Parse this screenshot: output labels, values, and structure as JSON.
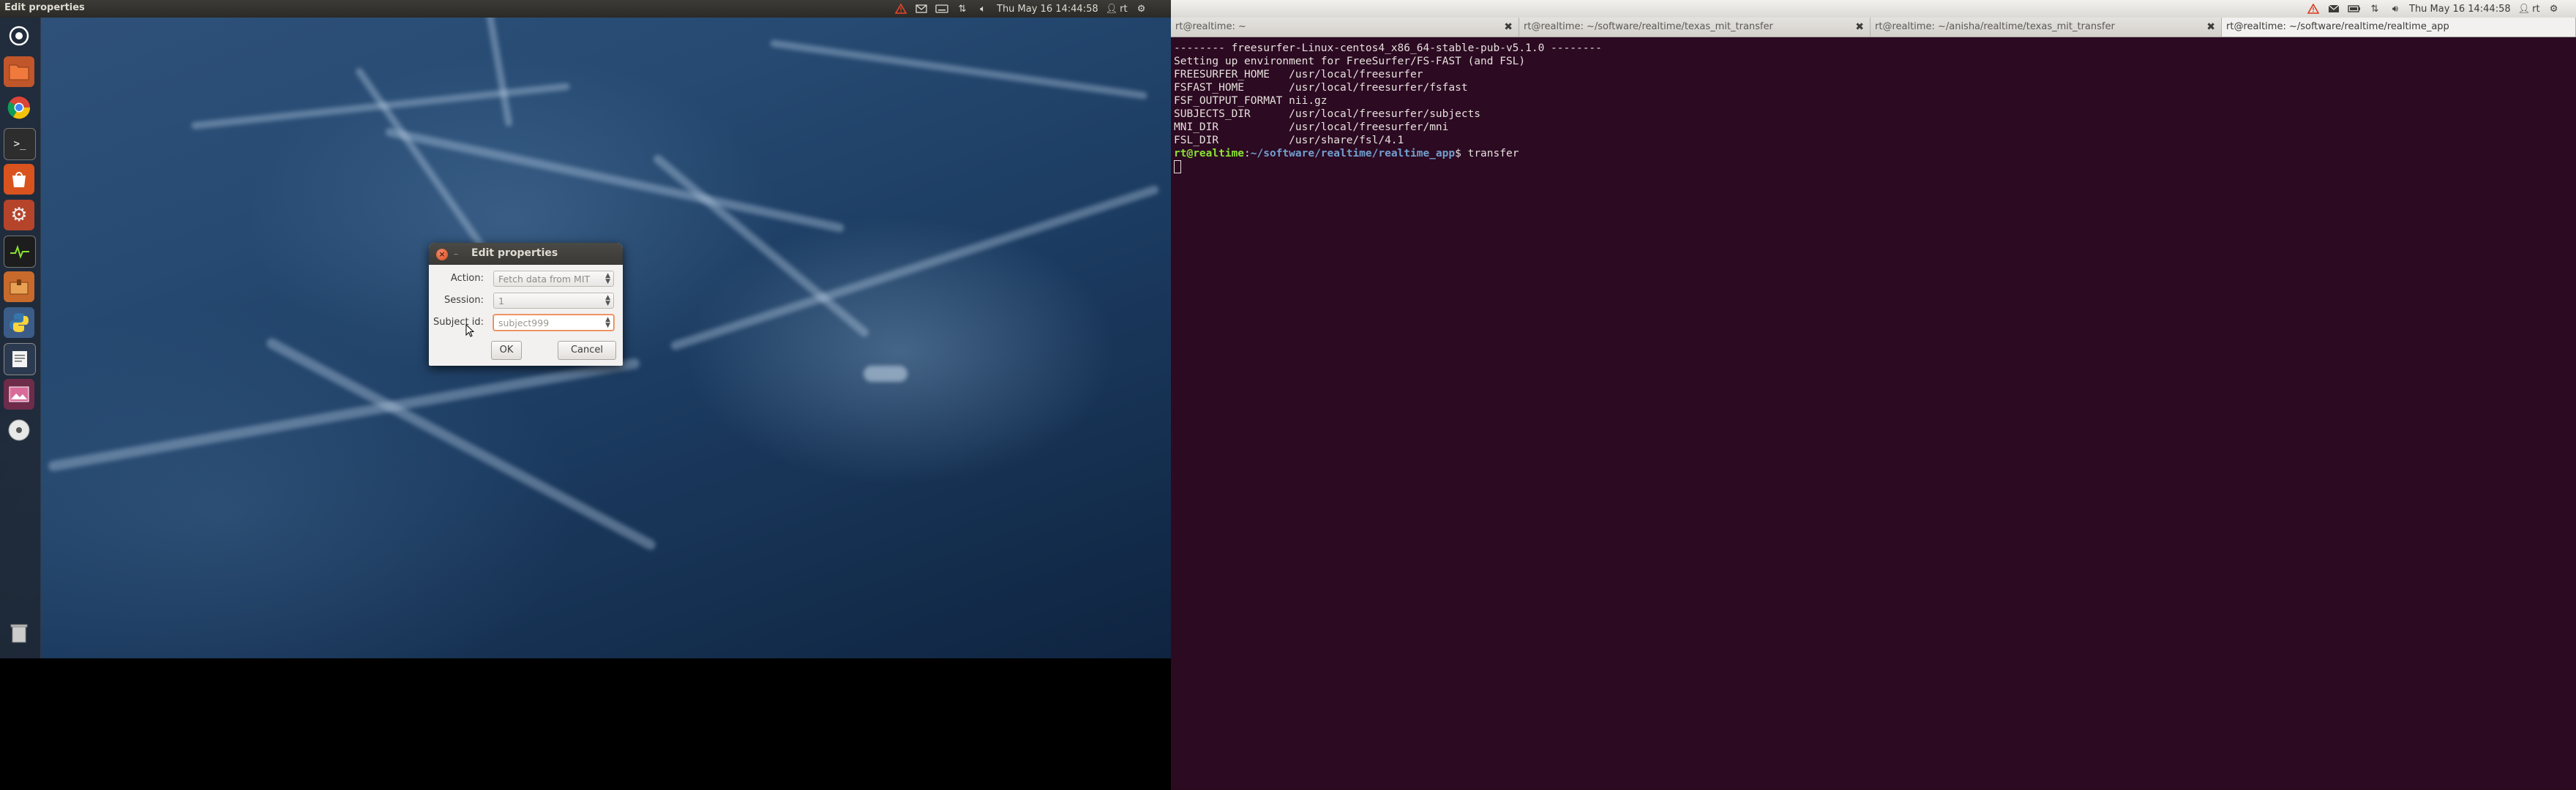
{
  "left_screen": {
    "topbar": {
      "window_title": "Edit properties",
      "clock": "Thu May 16 14:44:58",
      "user": "rt"
    },
    "launcher": {
      "icons": [
        "dash-home-icon",
        "files-icon",
        "chrome-icon",
        "terminal-icon",
        "software-center-icon",
        "system-settings-icon",
        "system-monitor-icon",
        "archive-manager-icon",
        "python-icon",
        "text-editor-icon",
        "image-viewer-icon",
        "disc-icon",
        "trash-icon"
      ]
    },
    "dialog": {
      "title": "Edit properties",
      "action_label": "Action:",
      "action_value": "Fetch data from MIT",
      "session_label": "Session:",
      "session_value": "1",
      "subject_label": "Subject id:",
      "subject_value": "subject999",
      "ok_label": "OK",
      "cancel_label": "Cancel"
    }
  },
  "right_screen": {
    "topbar": {
      "clock": "Thu May 16 14:44:58",
      "user": "rt"
    },
    "tabs": [
      {
        "title": "rt@realtime: ~"
      },
      {
        "title": "rt@realtime: ~/software/realtime/texas_mit_transfer"
      },
      {
        "title": "rt@realtime: ~/anisha/realtime/texas_mit_transfer"
      },
      {
        "title": "rt@realtime: ~/software/realtime/realtime_app"
      }
    ],
    "terminal": {
      "lines": [
        "-------- freesurfer-Linux-centos4_x86_64-stable-pub-v5.1.0 --------",
        "Setting up environment for FreeSurfer/FS-FAST (and FSL)",
        "FREESURFER_HOME   /usr/local/freesurfer",
        "FSFAST_HOME       /usr/local/freesurfer/fsfast",
        "FSF_OUTPUT_FORMAT nii.gz",
        "SUBJECTS_DIR      /usr/local/freesurfer/subjects",
        "MNI_DIR           /usr/local/freesurfer/mni",
        "FSL_DIR           /usr/share/fsl/4.1"
      ],
      "prompt_user": "rt@realtime",
      "prompt_sep": ":",
      "prompt_path": "~/software/realtime/realtime_app",
      "prompt_symbol": "$ ",
      "command": "transfer"
    }
  },
  "colors": {
    "terminal_bg": "#2c0a22",
    "prompt_user": "#8ae234",
    "prompt_path": "#729fcf",
    "ubuntu_orange": "#dd4814"
  }
}
